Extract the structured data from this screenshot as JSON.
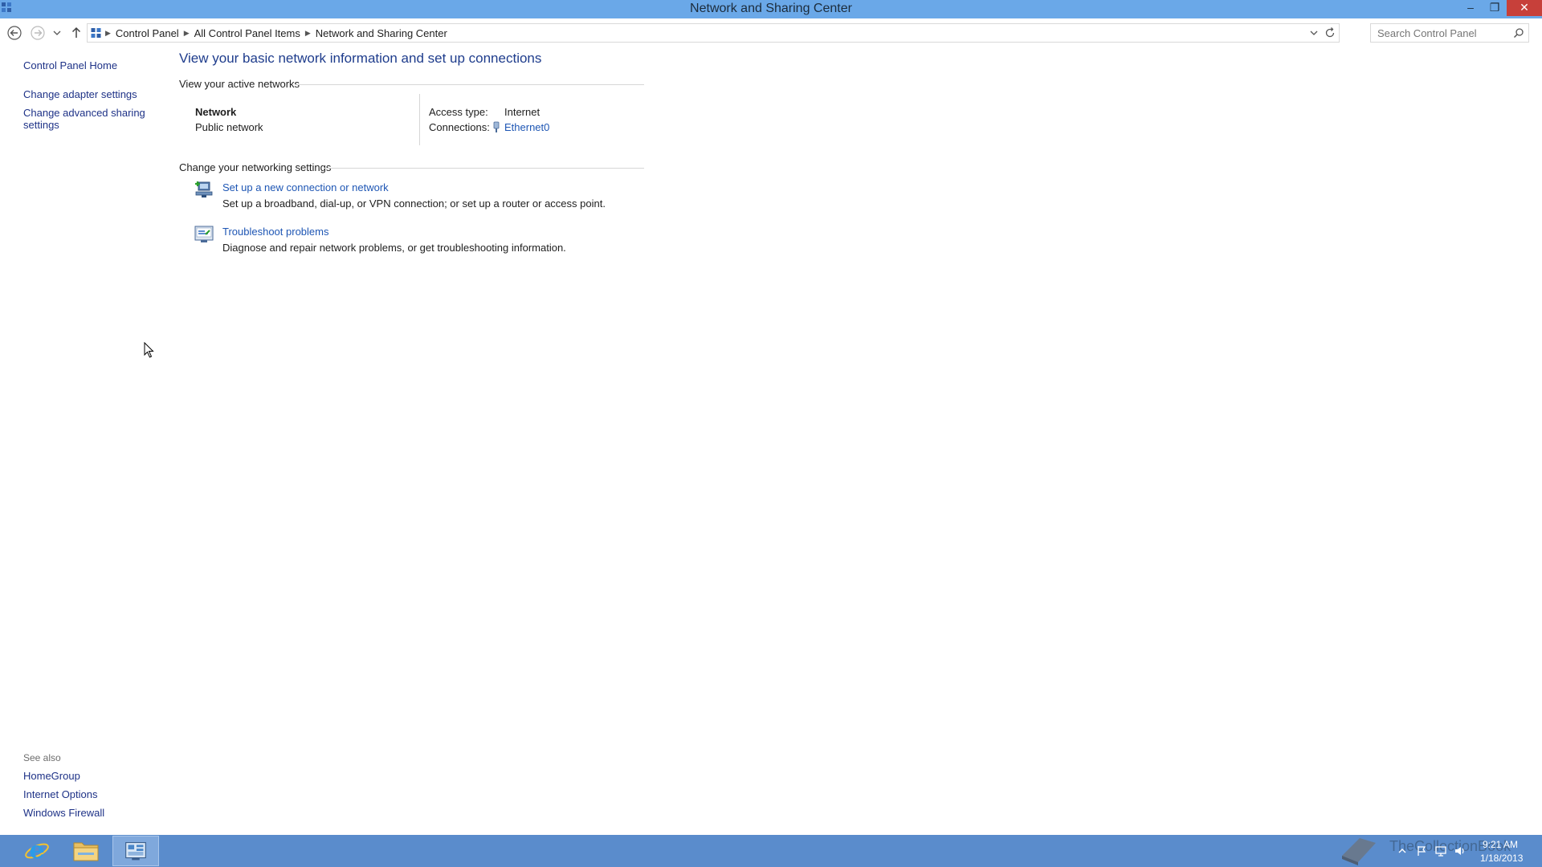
{
  "window": {
    "title": "Network and Sharing Center",
    "minimize_label": "–",
    "maximize_label": "❐",
    "close_label": "✕"
  },
  "address": {
    "crumbs": [
      "Control Panel",
      "All Control Panel Items",
      "Network and Sharing Center"
    ],
    "search_placeholder": "Search Control Panel"
  },
  "sidebar": {
    "home": "Control Panel Home",
    "links": [
      "Change adapter settings",
      "Change advanced sharing",
      "settings"
    ],
    "see_also_title": "See also",
    "see_also": [
      "HomeGroup",
      "Internet Options",
      "Windows Firewall"
    ]
  },
  "main": {
    "title": "View your basic network information and set up connections",
    "active_networks_heading": "View your active networks",
    "network": {
      "name": "Network",
      "type": "Public network",
      "access_type_label": "Access type:",
      "access_type_value": "Internet",
      "connections_label": "Connections:",
      "connections_value": "Ethernet0"
    },
    "settings_heading": "Change your networking settings",
    "tasks": [
      {
        "link": "Set up a new connection or network",
        "desc": "Set up a broadband, dial-up, or VPN connection; or set up a router or access point."
      },
      {
        "link": "Troubleshoot problems",
        "desc": "Diagnose and repair network problems, or get troubleshooting information."
      }
    ]
  },
  "taskbar": {
    "watermark": "TheCollectionBook",
    "time": "9:21 AM",
    "date": "1/18/2013"
  },
  "icons": [
    "control-panel-icon",
    "back-arrow-icon",
    "forward-arrow-icon",
    "recent-dropdown-icon",
    "up-arrow-icon",
    "chevron-down-icon",
    "refresh-icon",
    "search-icon",
    "network-setup-icon",
    "troubleshoot-icon",
    "ethernet-icon",
    "ie-icon",
    "folder-icon",
    "book-icon",
    "flag-icon",
    "speaker-icon"
  ]
}
